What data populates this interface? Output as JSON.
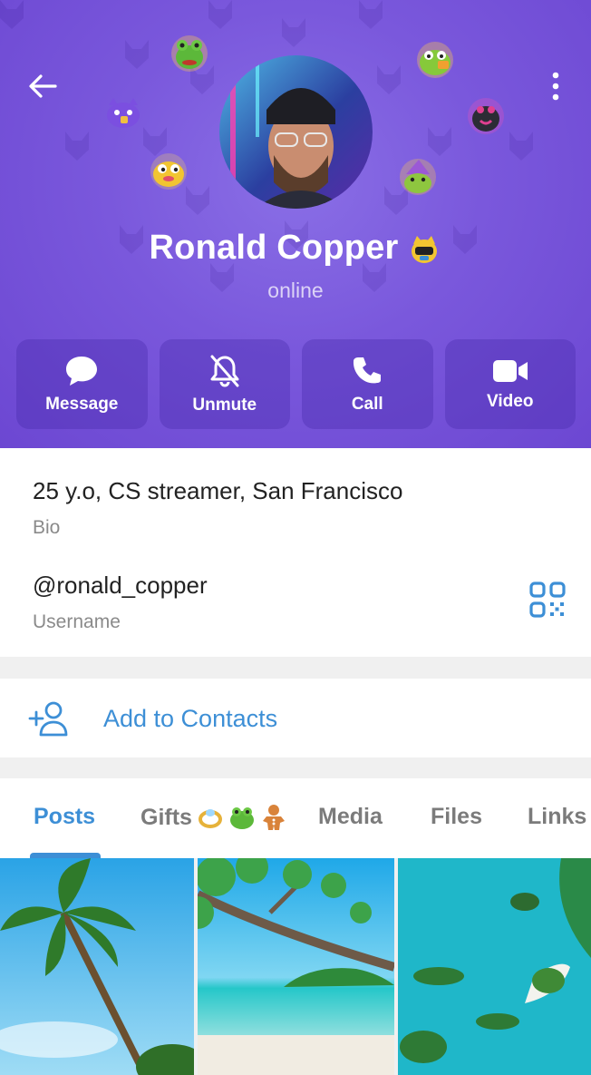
{
  "header": {
    "name": "Ronald Copper",
    "status": "online",
    "colors": {
      "background": "#7a58dc",
      "accent": "#3d8fd6"
    },
    "icons": {
      "back": "arrow-left-icon",
      "more": "more-vertical-icon",
      "badge": "emoji-status-icon"
    }
  },
  "actions": [
    {
      "label": "Message",
      "icon": "message-icon"
    },
    {
      "label": "Unmute",
      "icon": "bell-off-icon"
    },
    {
      "label": "Call",
      "icon": "phone-icon"
    },
    {
      "label": "Video",
      "icon": "video-icon"
    }
  ],
  "info": {
    "bio": "25 y.o, CS streamer, San Francisco",
    "bio_label": "Bio",
    "username": "@ronald_copper",
    "username_label": "Username"
  },
  "add_contact": {
    "label": "Add to Contacts"
  },
  "tabs": [
    {
      "label": "Posts",
      "active": true
    },
    {
      "label": "Gifts",
      "active": false
    },
    {
      "label": "Media",
      "active": false
    },
    {
      "label": "Files",
      "active": false
    },
    {
      "label": "Links",
      "active": false
    }
  ]
}
